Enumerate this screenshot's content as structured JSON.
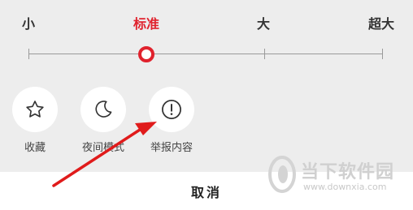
{
  "font_size": {
    "options": [
      "小",
      "标准",
      "大",
      "超大"
    ],
    "selected": "标准"
  },
  "actions": {
    "favorite": {
      "label": "收藏",
      "icon": "star-icon"
    },
    "night_mode": {
      "label": "夜间模式",
      "icon": "moon-icon"
    },
    "report": {
      "label": "举报内容",
      "icon": "exclamation-circle-icon"
    }
  },
  "cancel_label": "取消",
  "watermark": {
    "text": "当下软件园",
    "url": "www.downxia.com"
  },
  "colors": {
    "accent": "#e0222d",
    "sheet_bg": "#ededed"
  }
}
